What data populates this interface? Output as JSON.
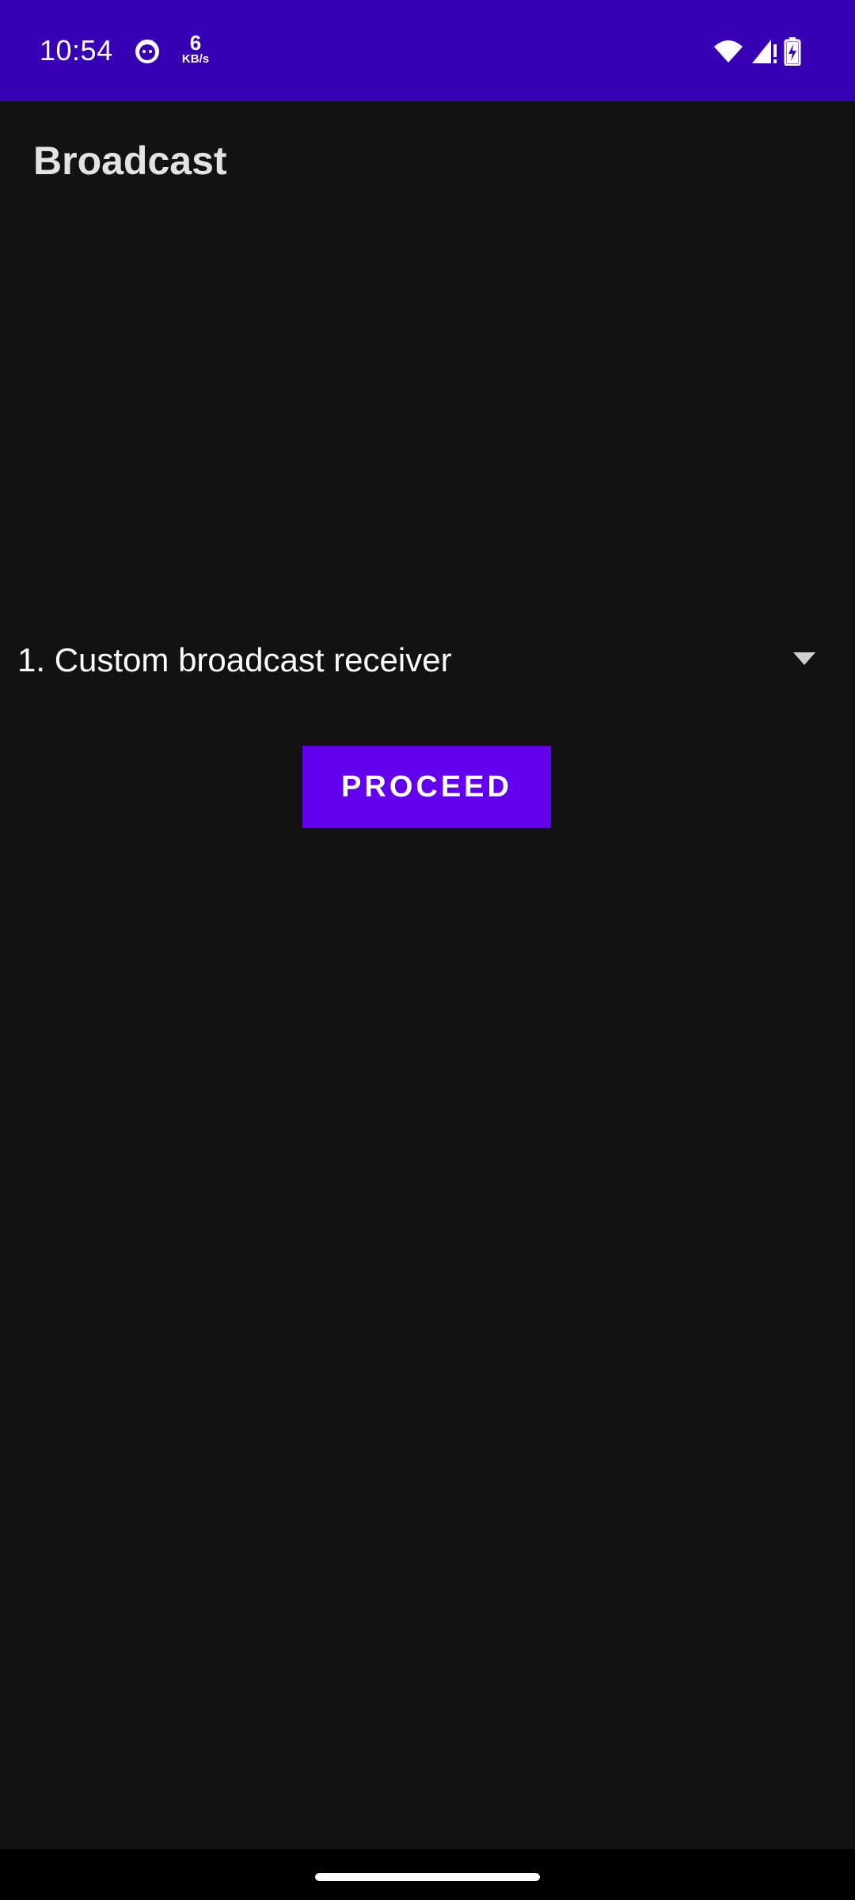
{
  "status_bar": {
    "time": "10:54",
    "app_icon": "cat-face-icon",
    "network_speed": "6",
    "network_speed_unit": "KB/s",
    "icons": [
      "wifi-icon",
      "cellular-signal-icon",
      "battery-charging-icon"
    ],
    "background_color": "#3700b3"
  },
  "app_bar": {
    "title": "Broadcast"
  },
  "spinner": {
    "selected_value": "1. Custom broadcast receiver",
    "arrow_icon": "dropdown-arrow-icon"
  },
  "actions": {
    "proceed_label": "PROCEED",
    "proceed_color": "#6200ee"
  },
  "nav_bar": {
    "handle": "gesture-handle"
  }
}
